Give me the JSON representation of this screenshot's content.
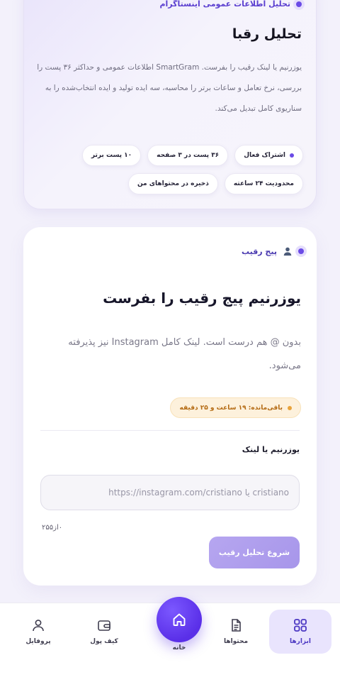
{
  "top_card": {
    "eyebrow": "تحلیل اطلاعات عمومی اینستاگرام",
    "title": "تحلیل رقبا",
    "description": "یوزرنیم یا لینک رقیب را بفرست. SmartGram اطلاعات عمومی و حداکثر ۳۶ پست را بررسی، نرخ تعامل و ساعات برتر را محاسبه، سه ایده تولید و ایده انتخاب‌شده را به سناریوی کامل تبدیل می‌کند.",
    "chips_row1": [
      {
        "label": "اشتراک فعال",
        "has_dot": true
      },
      {
        "label": "۳۶ پست در ۳ صفحه",
        "has_dot": false
      },
      {
        "label": "۱۰ پست برتر",
        "has_dot": false
      }
    ],
    "chips_row2": [
      {
        "label": "محدودیت ۲۴ ساعته"
      },
      {
        "label": "ذخیره در محتواهای من"
      }
    ]
  },
  "main_card": {
    "section_tag": "پیج رقیب",
    "heading": "یوزرنیم پیج رقیب را بفرست",
    "subtext": "بدون @ هم درست است. لینک کامل Instagram نیز پذیرفته می‌شود.",
    "timer": "باقی‌مانده: ۱۹ ساعت و ۲۵ دقیقه",
    "field_label": "یوزرنیم یا لینک",
    "input_placeholder": "cristiano یا https://instagram.com/cristiano",
    "counter": "۰از۲۵۵",
    "submit_label": "شروع تحلیل رقیب"
  },
  "nav": {
    "tools": "ابزارها",
    "contents": "محتواها",
    "home": "خانه",
    "wallet": "کیف پول",
    "profile": "پروفایل",
    "active": "tools"
  },
  "colors": {
    "accent": "#5a2fe8",
    "accent_soft": "#e9e4fd",
    "timer_bg": "#fdf1dc",
    "timer_text": "#b46a12",
    "button_bg": "#b6a6f0"
  }
}
